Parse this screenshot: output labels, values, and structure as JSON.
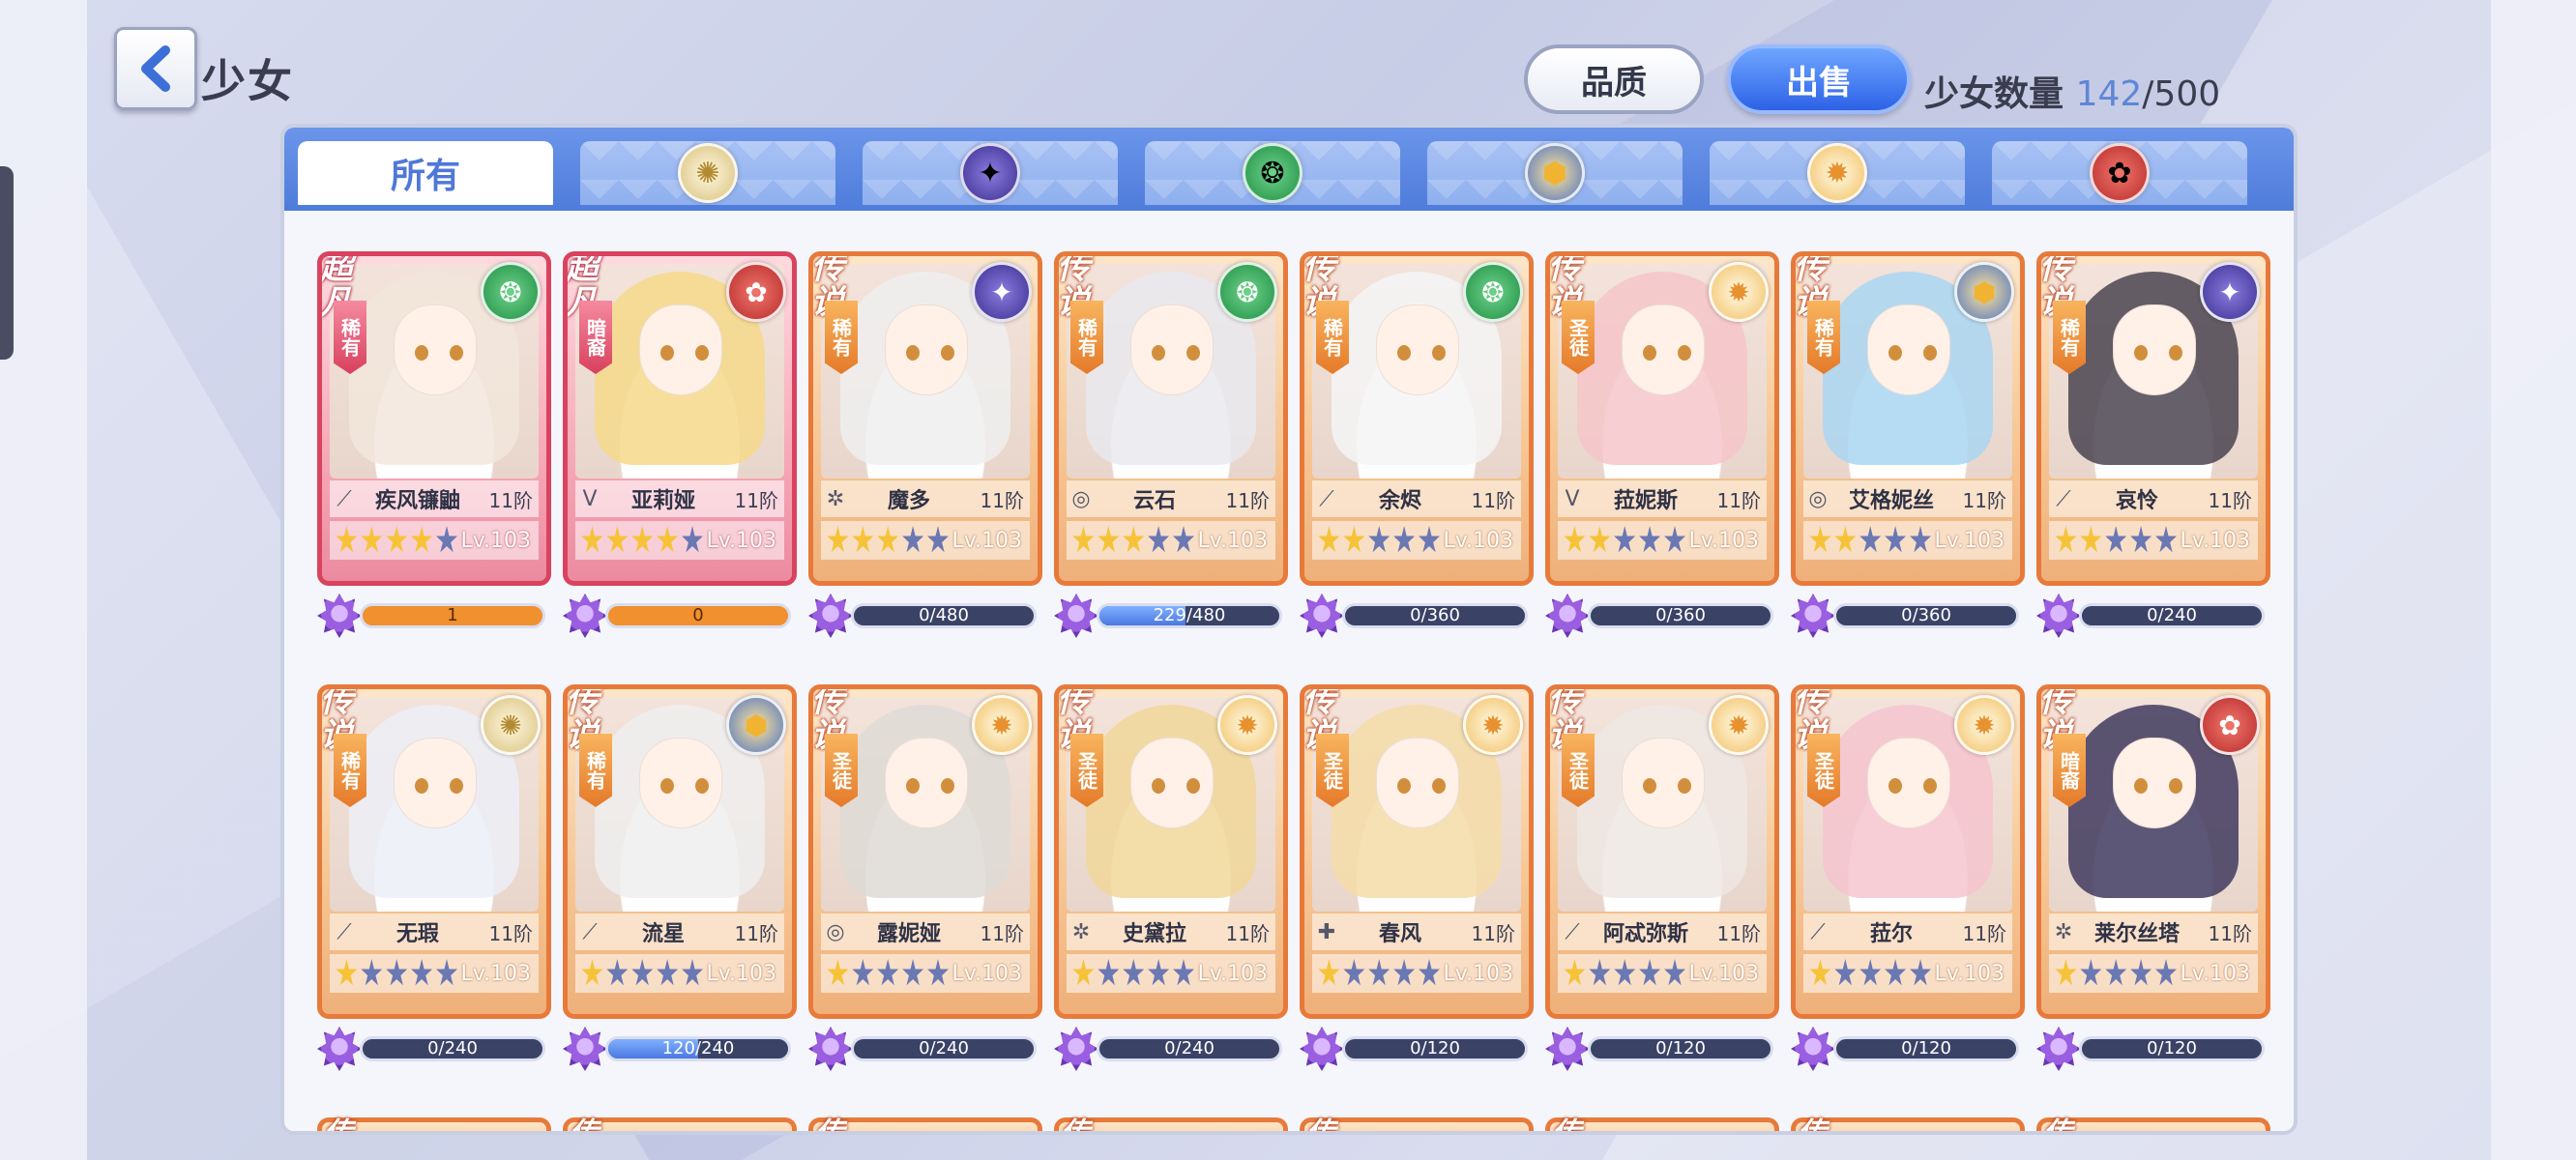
{
  "header": {
    "title": "少女",
    "quality_label": "品质",
    "sell_label": "出售",
    "count_label": "少女数量",
    "count_current": "142",
    "count_sep": "/",
    "count_max": "500"
  },
  "tabs": [
    {
      "label": "所有",
      "icon": "all",
      "active": true
    },
    {
      "label": "",
      "icon": "light-element-icon"
    },
    {
      "label": "",
      "icon": "dark-element-icon"
    },
    {
      "label": "",
      "icon": "wind-element-icon"
    },
    {
      "label": "",
      "icon": "earth-element-icon"
    },
    {
      "label": "",
      "icon": "holy-element-icon"
    },
    {
      "label": "",
      "icon": "fire-element-icon"
    }
  ],
  "cards": [
    {
      "rank": "超凡",
      "sub": "稀有",
      "element": "wind",
      "cls": "⟋",
      "name": "疾风镰鼬",
      "tier": "11阶",
      "stars": 4,
      "lv": "Lv.103",
      "frag": "1",
      "frag_ratio": 1,
      "super": true,
      "hair": "#f2e6dc"
    },
    {
      "rank": "超凡",
      "sub": "暗裔",
      "element": "fire",
      "cls": "V",
      "name": "亚莉娅",
      "tier": "11阶",
      "stars": 4,
      "lv": "Lv.103",
      "frag": "0",
      "frag_ratio": 1,
      "super": true,
      "hair": "#f6d98a"
    },
    {
      "rank": "传说",
      "sub": "稀有",
      "element": "dark",
      "cls": "✲",
      "name": "魔多",
      "tier": "11阶",
      "stars": 3,
      "lv": "Lv.103",
      "frag": "0/480",
      "frag_ratio": 0,
      "super": false,
      "hair": "#eeeeee"
    },
    {
      "rank": "传说",
      "sub": "稀有",
      "element": "wind",
      "cls": "◎",
      "name": "云石",
      "tier": "11阶",
      "stars": 3,
      "lv": "Lv.103",
      "frag": "229/480",
      "frag_ratio": 0.477,
      "super": false,
      "hair": "#e9e9ee"
    },
    {
      "rank": "传说",
      "sub": "稀有",
      "element": "wind",
      "cls": "⟋",
      "name": "余烬",
      "tier": "11阶",
      "stars": 2,
      "lv": "Lv.103",
      "frag": "0/360",
      "frag_ratio": 0,
      "super": false,
      "hair": "#f4f4f6"
    },
    {
      "rank": "传说",
      "sub": "圣徒",
      "element": "holy",
      "cls": "V",
      "name": "菈妮斯",
      "tier": "11阶",
      "stars": 2,
      "lv": "Lv.103",
      "frag": "0/360",
      "frag_ratio": 0,
      "super": false,
      "hair": "#f6c6c9"
    },
    {
      "rank": "传说",
      "sub": "稀有",
      "element": "earth",
      "cls": "◎",
      "name": "艾格妮丝",
      "tier": "11阶",
      "stars": 2,
      "lv": "Lv.103",
      "frag": "0/360",
      "frag_ratio": 0,
      "super": false,
      "hair": "#a9d6f2"
    },
    {
      "rank": "传说",
      "sub": "稀有",
      "element": "dark",
      "cls": "⟋",
      "name": "哀怜",
      "tier": "11阶",
      "stars": 2,
      "lv": "Lv.103",
      "frag": "0/240",
      "frag_ratio": 0,
      "super": false,
      "hair": "#4a4450"
    },
    {
      "rank": "传说",
      "sub": "稀有",
      "element": "light",
      "cls": "⟋",
      "name": "无瑕",
      "tier": "11阶",
      "stars": 1,
      "lv": "Lv.103",
      "frag": "0/240",
      "frag_ratio": 0,
      "super": false,
      "hair": "#eceff7"
    },
    {
      "rank": "传说",
      "sub": "稀有",
      "element": "earth",
      "cls": "⟋",
      "name": "流星",
      "tier": "11阶",
      "stars": 1,
      "lv": "Lv.103",
      "frag": "120/240",
      "frag_ratio": 0.5,
      "super": false,
      "hair": "#eeeeee"
    },
    {
      "rank": "传说",
      "sub": "圣徒",
      "element": "holy",
      "cls": "◎",
      "name": "露妮娅",
      "tier": "11阶",
      "stars": 1,
      "lv": "Lv.103",
      "frag": "0/240",
      "frag_ratio": 0,
      "super": false,
      "hair": "#dedbd6"
    },
    {
      "rank": "传说",
      "sub": "圣徒",
      "element": "holy",
      "cls": "✲",
      "name": "史黛拉",
      "tier": "11阶",
      "stars": 1,
      "lv": "Lv.103",
      "frag": "0/240",
      "frag_ratio": 0,
      "super": false,
      "hair": "#f1d79a"
    },
    {
      "rank": "传说",
      "sub": "圣徒",
      "element": "holy",
      "cls": "✚",
      "name": "春风",
      "tier": "11阶",
      "stars": 1,
      "lv": "Lv.103",
      "frag": "0/120",
      "frag_ratio": 0,
      "super": false,
      "hair": "#f5dca8"
    },
    {
      "rank": "传说",
      "sub": "圣徒",
      "element": "holy",
      "cls": "⟋",
      "name": "阿忒弥斯",
      "tier": "11阶",
      "stars": 1,
      "lv": "Lv.103",
      "frag": "0/120",
      "frag_ratio": 0,
      "super": false,
      "hair": "#efe8e4"
    },
    {
      "rank": "传说",
      "sub": "圣徒",
      "element": "holy",
      "cls": "⟋",
      "name": "菈尔",
      "tier": "11阶",
      "stars": 1,
      "lv": "Lv.103",
      "frag": "0/120",
      "frag_ratio": 0,
      "super": false,
      "hair": "#f6c4cf"
    },
    {
      "rank": "传说",
      "sub": "暗裔",
      "element": "fire",
      "cls": "✲",
      "name": "莱尔丝塔",
      "tier": "11阶",
      "stars": 1,
      "lv": "Lv.103",
      "frag": "0/120",
      "frag_ratio": 0,
      "super": false,
      "hair": "#3f3a5e"
    }
  ],
  "third_row_rank": "传",
  "colors": {
    "accent": "#4f7cdb",
    "legend_border": "#e77a3b",
    "super_border": "#d9435e",
    "star_on": "#f6c338",
    "star_off": "#6a78b3"
  }
}
